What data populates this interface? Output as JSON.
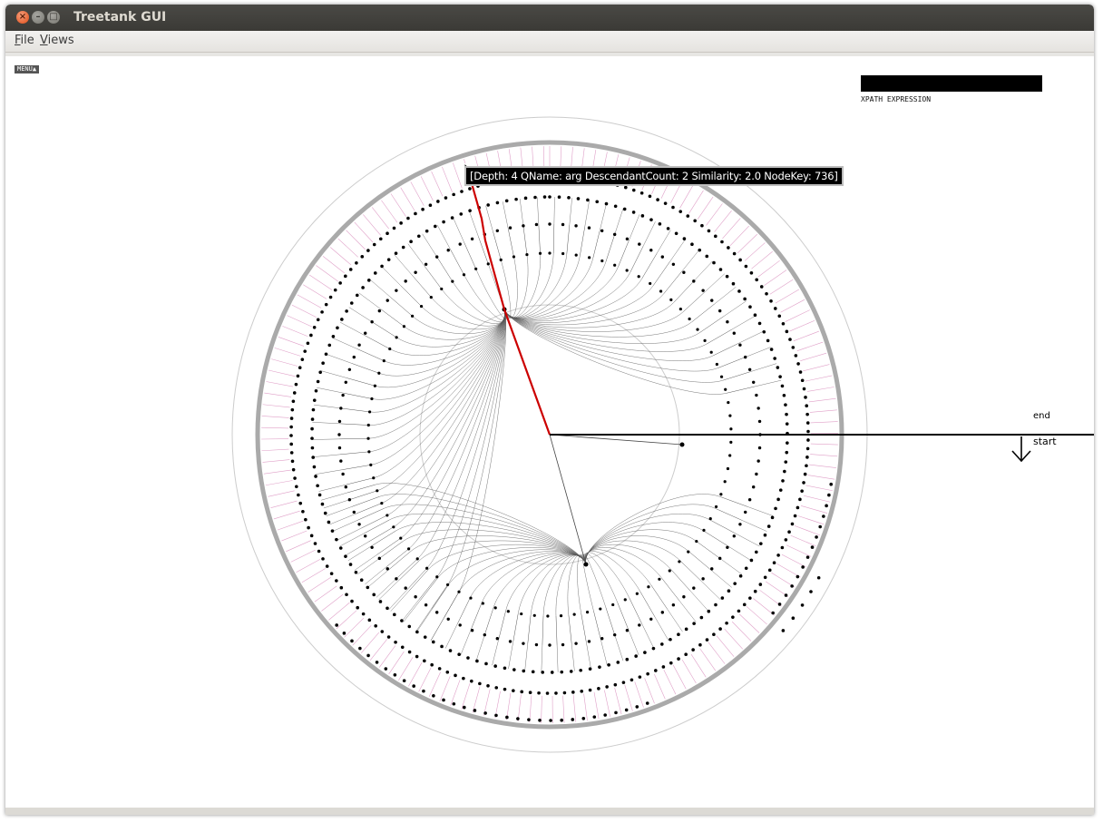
{
  "window": {
    "title": "Treetank GUI"
  },
  "menubar": {
    "file": {
      "mnemonic": "F",
      "rest": "ile"
    },
    "views": {
      "mnemonic": "V",
      "rest": "iews"
    }
  },
  "toolbar": {
    "menu_toggle_label": "MENU▲"
  },
  "xpath": {
    "label": "XPATH EXPRESSION",
    "value": ""
  },
  "tooltip": {
    "text": "[Depth: 4 QName: arg DescendantCount: 2 Similarity: 2.0 NodeKey: 736]"
  },
  "timeline": {
    "end_label": "end",
    "start_label": "start"
  },
  "colors": {
    "selected_path": "#cc0000",
    "edges": "#555555",
    "nodes": "#000000",
    "rings": "#aaaaaa",
    "minor_links": "#e0a0c8"
  },
  "icons": {
    "pointer": "mouse-pointer-icon",
    "down_arrow": "arrow-down-icon"
  }
}
